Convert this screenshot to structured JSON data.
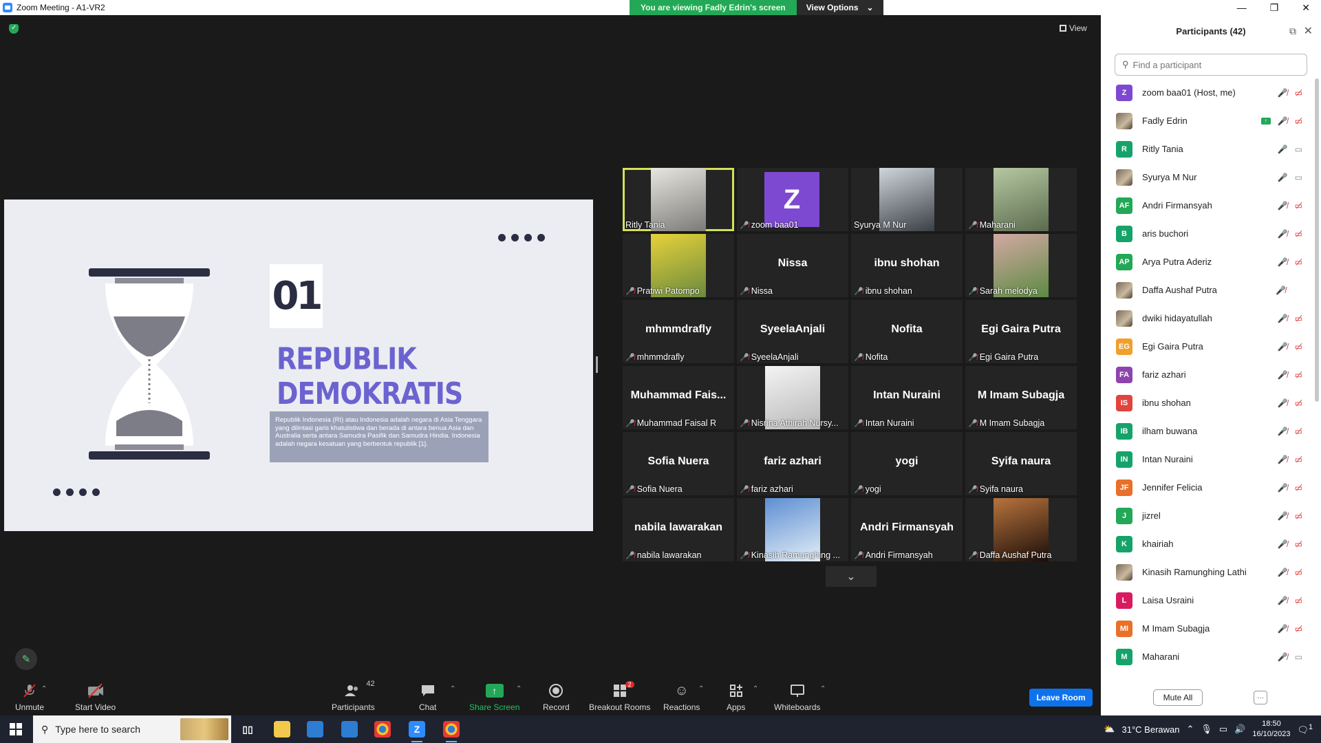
{
  "window": {
    "title": "Zoom Meeting - A1-VR2"
  },
  "viewing_bar": {
    "message": "You are viewing Fadly Edrin's screen",
    "options_label": "View Options"
  },
  "view_label": "View",
  "slide": {
    "number": "01",
    "heading": "REPUBLIK DEMOKRATIS",
    "paragraph": "Republik Indonesia (RI) atau Indonesia adalah negara di Asia Tenggara yang dilintasi garis khatulistiwa dan berada di antara benua Asia dan Australia serta antara Samudra Pasifik dan Samudra Hindia. Indonesia adalah negara kesatuan yang berbentuk republik [1]."
  },
  "gallery": [
    {
      "label": "Ritly Tania",
      "kind": "photo",
      "active": true,
      "muted": false,
      "colors": [
        "#e8e6e0",
        "#7d7b78"
      ]
    },
    {
      "label": "zoom baa01",
      "kind": "avatar",
      "muted": true
    },
    {
      "label": "Syurya M Nur",
      "kind": "photo",
      "muted": false,
      "colors": [
        "#cfd6dc",
        "#3b3f46"
      ]
    },
    {
      "label": "Maharani",
      "kind": "photo",
      "muted": true,
      "colors": [
        "#b6c8a2",
        "#5b6b4e"
      ]
    },
    {
      "label": "Pratiwi Patompo",
      "kind": "photo",
      "muted": true,
      "colors": [
        "#e6d23a",
        "#6b8a3e"
      ]
    },
    {
      "label": "Nissa",
      "big": "Nissa",
      "kind": "name",
      "muted": true
    },
    {
      "label": "ibnu shohan",
      "big": "ibnu shohan",
      "kind": "name",
      "muted": true
    },
    {
      "label": "Sarah melodya",
      "kind": "photo",
      "muted": true,
      "colors": [
        "#d3a9a4",
        "#5c8a42"
      ]
    },
    {
      "label": "mhmmdrafly",
      "big": "mhmmdrafly",
      "kind": "name",
      "muted": true
    },
    {
      "label": "SyeelaAnjali",
      "big": "SyeelaAnjali",
      "kind": "name",
      "muted": true
    },
    {
      "label": "Nofita",
      "big": "Nofita",
      "kind": "name",
      "muted": true
    },
    {
      "label": "Egi Gaira Putra",
      "big": "Egi Gaira Putra",
      "kind": "name",
      "muted": true
    },
    {
      "label": "Muhammad Faisal R",
      "big": "Muhammad Fais...",
      "kind": "name",
      "muted": true
    },
    {
      "label": "Nisrina Athirah Nursy...",
      "kind": "photo",
      "muted": true,
      "colors": [
        "#f4f4f4",
        "#b8b8b8"
      ]
    },
    {
      "label": "Intan Nuraini",
      "big": "Intan Nuraini",
      "kind": "name",
      "muted": true
    },
    {
      "label": "M Imam Subagja",
      "big": "M Imam Subagja",
      "kind": "name",
      "muted": true
    },
    {
      "label": "Sofia Nuera",
      "big": "Sofia Nuera",
      "kind": "name",
      "muted": true
    },
    {
      "label": "fariz azhari",
      "big": "fariz azhari",
      "kind": "name",
      "muted": true
    },
    {
      "label": "yogi",
      "big": "yogi",
      "kind": "name",
      "muted": true
    },
    {
      "label": "Syifa naura",
      "big": "Syifa naura",
      "kind": "name",
      "muted": true
    },
    {
      "label": "nabila lawarakan",
      "big": "nabila lawarakan",
      "kind": "name",
      "muted": true
    },
    {
      "label": "Kinasih Ramunghing ...",
      "kind": "photo",
      "muted": true,
      "colors": [
        "#5d8fd3",
        "#e4eef7"
      ]
    },
    {
      "label": "Andri Firmansyah",
      "big": "Andri Firmansyah",
      "kind": "name",
      "muted": true
    },
    {
      "label": "Daffa Aushaf Putra",
      "kind": "photo",
      "muted": true,
      "colors": [
        "#b8733e",
        "#1a0e08"
      ]
    }
  ],
  "toolbar": {
    "unmute": "Unmute",
    "start_video": "Start Video",
    "participants": "Participants",
    "participants_count": "42",
    "chat": "Chat",
    "share_screen": "Share Screen",
    "record": "Record",
    "breakout_rooms": "Breakout Rooms",
    "breakout_badge": "2",
    "reactions": "Reactions",
    "apps": "Apps",
    "whiteboards": "Whiteboards",
    "leave": "Leave Room"
  },
  "panel": {
    "title": "Participants (42)",
    "search_placeholder": "Find a participant",
    "mute_all": "Mute All",
    "more": "···",
    "participants": [
      {
        "name": "zoom baa01 (Host, me)",
        "initials": "Z",
        "color": "#7e49d1",
        "mic": "off",
        "video": "off"
      },
      {
        "name": "Fadly Edrin",
        "initials": "",
        "color": "photo",
        "mic": "off",
        "video": "off",
        "sharing": true
      },
      {
        "name": "Ritly Tania",
        "initials": "R",
        "color": "#15a36a",
        "mic": "on",
        "video": "on"
      },
      {
        "name": "Syurya M Nur",
        "initials": "",
        "color": "photo",
        "mic": "on",
        "video": "on"
      },
      {
        "name": "Andri Firmansyah",
        "initials": "AF",
        "color": "#23a857",
        "mic": "off",
        "video": "off"
      },
      {
        "name": "aris buchori",
        "initials": "B",
        "color": "#15a36a",
        "mic": "off",
        "video": "off"
      },
      {
        "name": "Arya Putra Aderiz",
        "initials": "AP",
        "color": "#23a857",
        "mic": "off",
        "video": "off"
      },
      {
        "name": "Daffa Aushaf Putra",
        "initials": "",
        "color": "photo",
        "mic": "off",
        "video": "none"
      },
      {
        "name": "dwiki hidayatullah",
        "initials": "",
        "color": "photo",
        "mic": "off",
        "video": "off"
      },
      {
        "name": "Egi Gaira Putra",
        "initials": "EG",
        "color": "#f0a02c",
        "mic": "off",
        "video": "off"
      },
      {
        "name": "fariz azhari",
        "initials": "FA",
        "color": "#8e44ad",
        "mic": "off",
        "video": "off"
      },
      {
        "name": "ibnu shohan",
        "initials": "IS",
        "color": "#e0443e",
        "mic": "off",
        "video": "off"
      },
      {
        "name": "ilham buwana",
        "initials": "IB",
        "color": "#15a36a",
        "mic": "off",
        "video": "off"
      },
      {
        "name": "Intan Nuraini",
        "initials": "IN",
        "color": "#15a36a",
        "mic": "off",
        "video": "off"
      },
      {
        "name": "Jennifer Felicia",
        "initials": "JF",
        "color": "#e8702a",
        "mic": "off",
        "video": "off"
      },
      {
        "name": "jizrel",
        "initials": "J",
        "color": "#23a857",
        "mic": "off",
        "video": "off"
      },
      {
        "name": "khairiah",
        "initials": "K",
        "color": "#15a36a",
        "mic": "off",
        "video": "off"
      },
      {
        "name": "Kinasih Ramunghing Lathi",
        "initials": "",
        "color": "photo",
        "mic": "off",
        "video": "off"
      },
      {
        "name": "Laisa Usraini",
        "initials": "L",
        "color": "#d81b60",
        "mic": "off",
        "video": "off"
      },
      {
        "name": "M Imam Subagja",
        "initials": "MI",
        "color": "#e8702a",
        "mic": "off",
        "video": "off"
      },
      {
        "name": "Maharani",
        "initials": "M",
        "color": "#15a36a",
        "mic": "off",
        "video": "on-grey"
      }
    ]
  },
  "taskbar": {
    "search_placeholder": "Type here to search",
    "weather": "31°C Berawan",
    "time": "18:50",
    "date": "16/10/2023",
    "notification_count": "1"
  }
}
